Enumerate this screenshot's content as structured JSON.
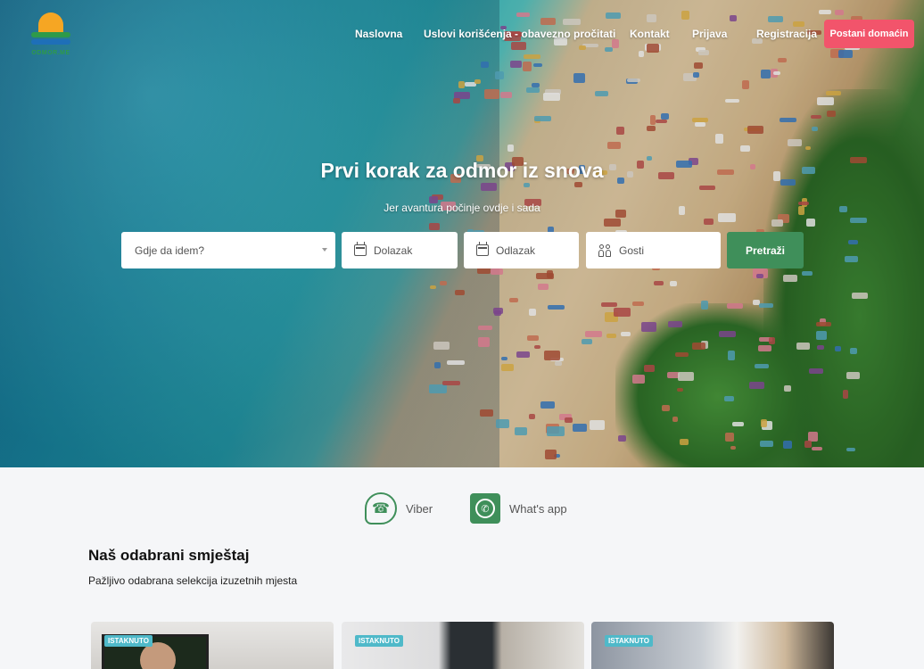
{
  "brand": {
    "logo_text": "ODMOR.ME",
    "colors": {
      "accent_pink": "#f2546b",
      "accent_green": "#3f8f5a",
      "badge": "#4fb9c9"
    }
  },
  "nav": {
    "items": [
      "Naslovna",
      "Uslovi korišćenja - obavezno pročitati",
      "Kontakt",
      "Prijava",
      "Registracija"
    ],
    "cta": "Postani domaćin"
  },
  "hero": {
    "title": "Prvi korak za odmor iz snova",
    "subtitle": "Jer avantura počinje ovdje i sada"
  },
  "search": {
    "destination_placeholder": "Gdje da idem?",
    "checkin_placeholder": "Dolazak",
    "checkout_placeholder": "Odlazak",
    "guests_placeholder": "Gosti",
    "button": "Pretraži",
    "icons": {
      "date": "calendar-icon",
      "guests": "people-icon"
    }
  },
  "contacts": {
    "viber": {
      "label": "Viber",
      "icon": "viber-icon"
    },
    "whatsapp": {
      "label": "What's app",
      "icon": "whatsapp-icon"
    }
  },
  "featured": {
    "title": "Naš odabrani smještaj",
    "subtitle": "Pažljivo odabrana selekcija izuzetnih mjesta",
    "cards": [
      {
        "badge": "ISTAKNUTO"
      },
      {
        "badge": "ISTAKNUTO"
      },
      {
        "badge": "ISTAKNUTO"
      }
    ]
  }
}
